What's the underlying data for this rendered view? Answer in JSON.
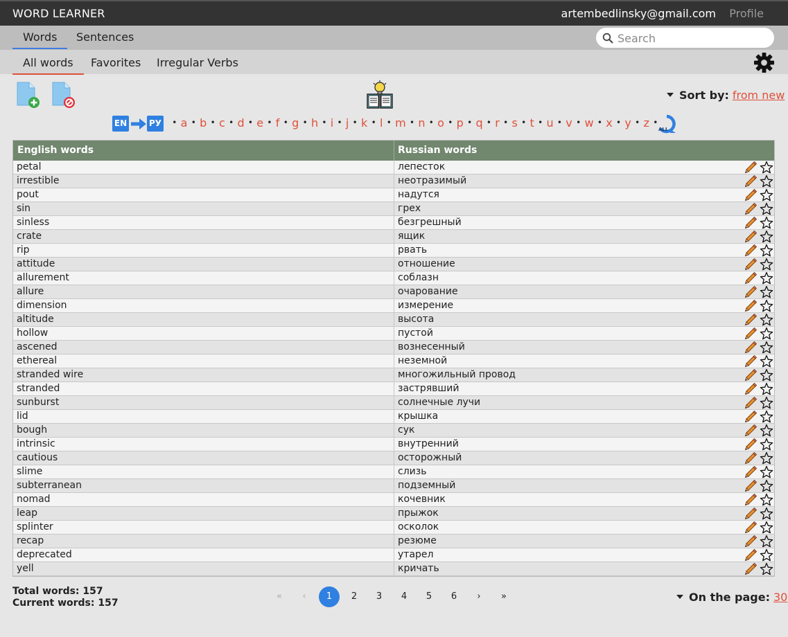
{
  "header": {
    "app_title": "WORD LEARNER",
    "user_email": "artembedlinsky@gmail.com",
    "profile_label": "Profile"
  },
  "main_tabs": [
    {
      "label": "Words",
      "active": true
    },
    {
      "label": "Sentences",
      "active": false
    }
  ],
  "search": {
    "placeholder": "Search",
    "value": ""
  },
  "sub_tabs": [
    {
      "label": "All words",
      "active": true
    },
    {
      "label": "Favorites",
      "active": false
    },
    {
      "label": "Irregular Verbs",
      "active": false
    }
  ],
  "toolbar": {
    "add_file_icon": "file-add-icon",
    "remove_file_icon": "file-remove-icon",
    "learn_icon": "book-lightbulb-icon",
    "settings_icon": "gear-icon",
    "sort_label": "Sort by:",
    "sort_value": "from new"
  },
  "language": {
    "from": "EN",
    "to": "РУ",
    "all_label": "ALL"
  },
  "alphabet": [
    "a",
    "b",
    "c",
    "d",
    "e",
    "f",
    "g",
    "h",
    "i",
    "j",
    "k",
    "l",
    "m",
    "n",
    "o",
    "p",
    "q",
    "r",
    "s",
    "t",
    "u",
    "v",
    "w",
    "x",
    "y",
    "z"
  ],
  "table": {
    "headers": [
      "English words",
      "Russian words"
    ],
    "rows": [
      {
        "en": "petal",
        "ru": "лепесток"
      },
      {
        "en": "irrestible",
        "ru": "неотразимый"
      },
      {
        "en": "pout",
        "ru": "надутся"
      },
      {
        "en": "sin",
        "ru": "грех"
      },
      {
        "en": "sinless",
        "ru": "безгрешный"
      },
      {
        "en": "crate",
        "ru": "ящик"
      },
      {
        "en": "rip",
        "ru": "рвать"
      },
      {
        "en": "attitude",
        "ru": "отношение"
      },
      {
        "en": "allurement",
        "ru": "соблазн"
      },
      {
        "en": "allure",
        "ru": "очарование"
      },
      {
        "en": "dimension",
        "ru": "измерение"
      },
      {
        "en": "altitude",
        "ru": "высота"
      },
      {
        "en": "hollow",
        "ru": "пустой"
      },
      {
        "en": "ascened",
        "ru": "вознесенный"
      },
      {
        "en": "ethereal",
        "ru": "неземной"
      },
      {
        "en": "stranded wire",
        "ru": "многожильный провод"
      },
      {
        "en": "stranded",
        "ru": "застрявший"
      },
      {
        "en": "sunburst",
        "ru": "солнечные лучи"
      },
      {
        "en": "lid",
        "ru": "крышка"
      },
      {
        "en": "bough",
        "ru": "сук"
      },
      {
        "en": "intrinsic",
        "ru": "внутренний"
      },
      {
        "en": "cautious",
        "ru": "осторожный"
      },
      {
        "en": "slime",
        "ru": "слизь"
      },
      {
        "en": "subterranean",
        "ru": "подземный"
      },
      {
        "en": "nomad",
        "ru": "кочевник"
      },
      {
        "en": "leap",
        "ru": "прыжок"
      },
      {
        "en": "splinter",
        "ru": "осколок"
      },
      {
        "en": "recap",
        "ru": "резюме"
      },
      {
        "en": "deprecated",
        "ru": "утарел"
      },
      {
        "en": "yell",
        "ru": "кричать"
      }
    ]
  },
  "footer": {
    "total_words": "Total words: 157",
    "current_words": "Current words: 157",
    "pagination": [
      "«",
      "‹",
      "1",
      "2",
      "3",
      "4",
      "5",
      "6",
      "›",
      "»"
    ],
    "current_page": "1",
    "per_page_label": "On the page:",
    "per_page_value": "30"
  },
  "colors": {
    "accent_red": "#e0503a",
    "accent_blue": "#2f80e0",
    "table_header": "#71876e",
    "topbar": "#333333"
  }
}
